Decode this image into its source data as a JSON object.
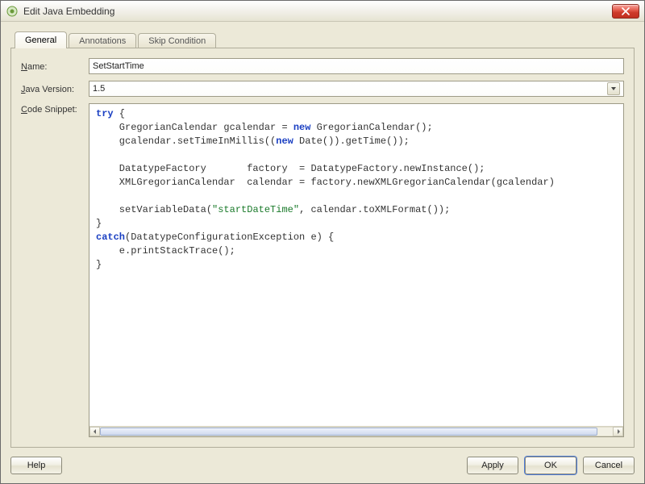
{
  "window": {
    "title": "Edit Java Embedding"
  },
  "tabs": [
    {
      "label": "General",
      "active": true
    },
    {
      "label": "Annotations",
      "active": false
    },
    {
      "label": "Skip Condition",
      "active": false
    }
  ],
  "labels": {
    "name_prefix": "N",
    "name_rest": "ame:",
    "java_version_prefix": "J",
    "java_version_rest": "ava Version:",
    "code_prefix": "C",
    "code_rest": "ode Snippet:"
  },
  "fields": {
    "name_value": "SetStartTime",
    "java_version_value": "1.5"
  },
  "code": {
    "l1a": "try",
    "l1b": " {",
    "l2a": "    GregorianCalendar gcalendar = ",
    "l2b": "new",
    "l2c": " GregorianCalendar();",
    "l3a": "    gcalendar.setTimeInMillis((",
    "l3b": "new",
    "l3c": " Date()).getTime());",
    "blank1": "",
    "l4": "    DatatypeFactory       factory  = DatatypeFactory.newInstance();",
    "l5": "    XMLGregorianCalendar  calendar = factory.newXMLGregorianCalendar(gcalendar)",
    "blank2": "",
    "l6a": "    setVariableData(",
    "l6b": "\"startDateTime\"",
    "l6c": ", calendar.toXMLFormat());",
    "l7": "}",
    "l8a": "catch",
    "l8b": "(DatatypeConfigurationException e) {",
    "l9": "    e.printStackTrace();",
    "l10": "}"
  },
  "buttons": {
    "help": "Help",
    "apply": "Apply",
    "ok": "OK",
    "cancel": "Cancel"
  }
}
